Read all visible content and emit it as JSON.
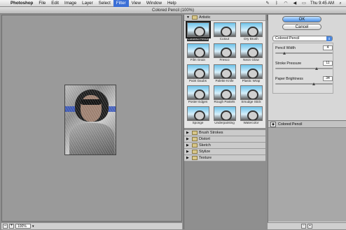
{
  "menubar": {
    "apple": "",
    "items": [
      "Photoshop",
      "File",
      "Edit",
      "Image",
      "Layer",
      "Select",
      "Filter",
      "View",
      "Window",
      "Help"
    ],
    "active_index": 6,
    "clock": "Thu 9:45 AM"
  },
  "window": {
    "title": "Colored Pencil (100%)"
  },
  "statusbar": {
    "minus": "–",
    "plus": "+",
    "zoom": "100%"
  },
  "gallery": {
    "open_category": "Artistic",
    "thumbnails": [
      {
        "label": "Colored Pencil",
        "selected": true
      },
      {
        "label": "Cutout"
      },
      {
        "label": "Dry Brush"
      },
      {
        "label": "Film Grain"
      },
      {
        "label": "Fresco"
      },
      {
        "label": "Neon Glow"
      },
      {
        "label": "Paint Daubs"
      },
      {
        "label": "Palette Knife"
      },
      {
        "label": "Plastic Wrap"
      },
      {
        "label": "Poster Edges"
      },
      {
        "label": "Rough Pastels"
      },
      {
        "label": "Smudge Stick"
      },
      {
        "label": "Sponge"
      },
      {
        "label": "Underpainting"
      },
      {
        "label": "Watercolor"
      }
    ],
    "categories": [
      "Brush Strokes",
      "Distort",
      "Sketch",
      "Stylize",
      "Texture"
    ]
  },
  "settings": {
    "ok": "OK",
    "cancel": "Cancel",
    "filter_select": "Colored Pencil",
    "params": [
      {
        "label": "Pencil Width",
        "value": "4",
        "fraction": 0.17
      },
      {
        "label": "Stroke Pressure",
        "value": "11",
        "fraction": 0.73
      },
      {
        "label": "Paper Brightness",
        "value": "34",
        "fraction": 0.68
      }
    ]
  },
  "layers": {
    "items": [
      "Colored Pencil"
    ]
  }
}
